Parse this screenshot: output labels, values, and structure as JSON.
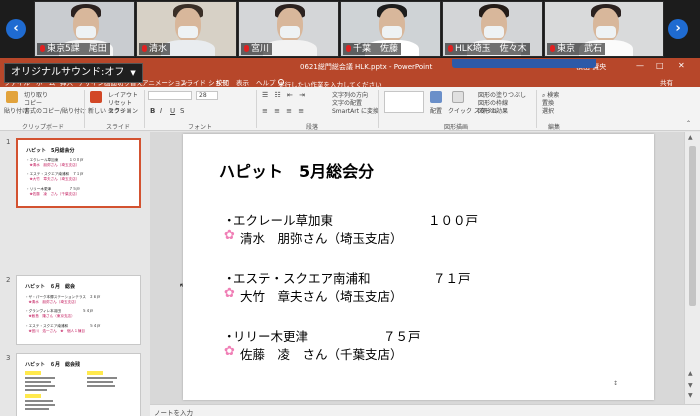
{
  "video": {
    "participants": [
      {
        "name": "東京5課　尾田",
        "bg": "#c9ccd0",
        "hair": "#2a211d"
      },
      {
        "name": "清水",
        "bg": "#d7d1c6",
        "hair": "#3a2f27"
      },
      {
        "name": "宮川",
        "bg": "#d4d6d8",
        "hair": "#2c2420"
      },
      {
        "name": "千葉　佐藤",
        "bg": "#cfd3d6",
        "hair": "#1d1d1d"
      },
      {
        "name": "HLK埼玉　佐々木",
        "bg": "#d3d5d7",
        "hair": "#241c18"
      },
      {
        "name": "東京　武石",
        "bg": "#d9dadb",
        "hair": "#2b2220"
      }
    ],
    "prev_icon": "‹",
    "next_icon": "›"
  },
  "window": {
    "sound_label": "オリジナルサウンド:オフ",
    "doc_title": "0621総門総会議 HLK.pptx  -  PowerPoint",
    "user": "横山 賢央",
    "accent": "#b7472a"
  },
  "tabs": {
    "file": "ファイル",
    "home": "ホーム",
    "insert": "挿入",
    "design": "デザイン",
    "transitions": "画面切り替え",
    "animations": "アニメーション",
    "slideshow": "スライド ショー",
    "review": "校閲",
    "view": "表示",
    "help": "ヘルプ",
    "tell_me": "実行したい作業を入力してください",
    "share": "共有"
  },
  "ribbon": {
    "paste": "貼り付け",
    "cut": "切り取り",
    "copy": "コピー",
    "format_painter": "書式のコピー/貼り付け",
    "clipboard_group": "クリップボード",
    "new_slide": "新しい\nスライド",
    "layout": "レイアウト",
    "reset": "リセット",
    "section": "セクション",
    "slides_group": "スライド",
    "font_size": "28",
    "font_group": "フォント",
    "text_direction": "文字列の方向",
    "align_text": "文字の配置",
    "smartart": "SmartArt に変換",
    "paragraph_group": "段落",
    "arrange": "配置",
    "quick_styles": "クイック\nスタイル",
    "shape_fill": "図形の塗りつぶし",
    "shape_outline": "図形の枠線",
    "shape_effects": "図形の効果",
    "drawing_group": "図形描画",
    "find": "検索",
    "replace": "置換",
    "select": "選択",
    "editing_group": "編集"
  },
  "thumbnails": [
    {
      "number": "1",
      "title": "ハピット　5月総会分",
      "lines": [
        "・エクレール草加東　　　１００戸",
        "　❀清水　朋弥さん（埼玉支店）",
        "・エステ・スクエア南浦和　７１戸",
        "　❀大竹　章夫さん（埼玉支店）",
        "・リリー木更津　　　　　７５戸",
        "　❀佐藤　凌　さん（千葉支店）"
      ]
    },
    {
      "number": "2",
      "title": "ハピット　６月　総会",
      "lines": [
        "・ザ・パーク本郷ステーションテラス　２６戸",
        "　❀清水　朋弥さん（埼玉支店）",
        "・グランヴィレ本羽田　　　　　　５４戸",
        "　❀飯島　隆さん（東京支店）",
        "・エステ・スクエア南浦和　　　　　　５４戸",
        "　❀宮川　浩一さん　❀　個人１棟目"
      ]
    },
    {
      "number": "3",
      "title": "ハピット　６月　総会残",
      "lines": []
    }
  ],
  "slide": {
    "title": "ハピット　5月総会分",
    "entries": [
      {
        "store": "エクレール草加東",
        "units": "１００戸",
        "person": "清水　朋弥さん（埼玉支店）"
      },
      {
        "store": "エステ・スクエア南浦和",
        "units": "７１戸",
        "person": "大竹　章夫さん（埼玉支店）"
      },
      {
        "store": "リリー木更津",
        "units": "７５戸",
        "person": "佐藤　凌　さん（千葉支店）"
      }
    ],
    "bullet": "・",
    "flower_icon": "✿",
    "page_marker": "↕"
  },
  "notes": {
    "placeholder": "ノートを入力"
  }
}
